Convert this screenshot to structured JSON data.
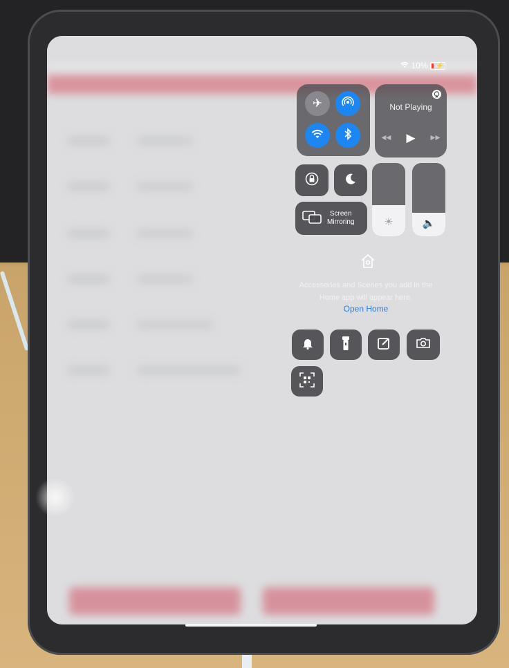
{
  "status_bar": {
    "wifi_icon": "wifi-icon",
    "battery_text": "10%"
  },
  "connectivity": {
    "airplane": "airplane-icon",
    "airdrop": "airdrop-icon",
    "wifi": "wifi-icon",
    "bluetooth": "bluetooth-icon"
  },
  "now_playing": {
    "title": "Not Playing",
    "airplay_icon": "airplay-icon",
    "controls": [
      "◂◂",
      "▶",
      "▸▸"
    ]
  },
  "toggles": {
    "rotation_lock": "rotation-lock-icon",
    "do_not_disturb": "moon-icon"
  },
  "screen_mirroring": {
    "line1": "Screen",
    "line2": "Mirroring"
  },
  "sliders": {
    "brightness_level": 0.42,
    "volume_level": 0.32
  },
  "home": {
    "icon": "home-icon",
    "message": "Accessories and Scenes you add in the Home app will appear here.",
    "link": "Open Home"
  },
  "quick_buttons": [
    "bell-icon",
    "flashlight-icon",
    "notes-icon",
    "camera-icon",
    "qr-scanner-icon"
  ],
  "colors": {
    "accent_blue": "#1c86f2",
    "app_red": "#cf3446"
  }
}
